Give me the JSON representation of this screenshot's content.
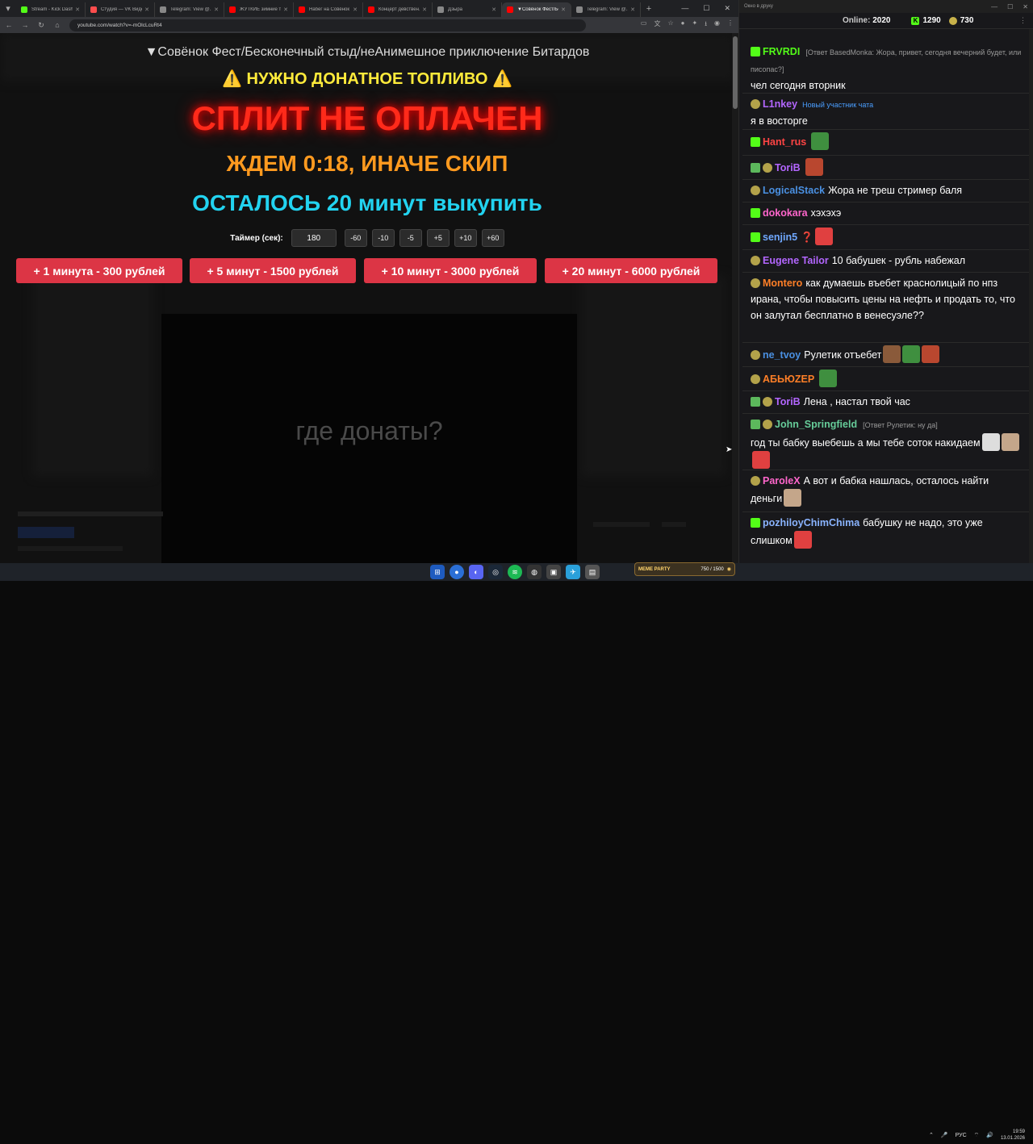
{
  "browser": {
    "tabs": [
      {
        "label": "Stream - Kick Dashb",
        "color": "#53fc18"
      },
      {
        "label": "Студия — VK Видео",
        "color": "#ff4d4d"
      },
      {
        "label": "Telegram: View @...",
        "color": "#888888"
      },
      {
        "label": "ЖУТКИЕ зимние т...",
        "color": "#ff0000"
      },
      {
        "label": "Набег на Совёнок",
        "color": "#ff0000"
      },
      {
        "label": "Концерт девствен...",
        "color": "#ff0000"
      },
      {
        "label": "Дзыра",
        "color": "#888888"
      },
      {
        "label": "▼Совёнок Фест/Бе...",
        "color": "#ff0000",
        "active": true
      },
      {
        "label": "Telegram: View @...",
        "color": "#888888"
      }
    ],
    "url": "youtube.com/watch?v=-mOlcLcuRt4"
  },
  "overlay": {
    "title": "▼Совёнок Фест/Бесконечный стыд/неАнимешное приключение Битардов",
    "fuel": "⚠️ НУЖНО ДОНАТНОЕ ТОПЛИВО ⚠️",
    "split": "СПЛИТ НЕ ОПЛАЧЕН",
    "wait": "ЖДЕМ 0:18, ИНАЧЕ СКИП",
    "remain": "ОСТАЛОСЬ 20 минут выкупить",
    "timer_label": "Таймер (сек):",
    "timer_value": "180",
    "timer_buttons": [
      "-60",
      "-10",
      "-5",
      "+5",
      "+10",
      "+60"
    ],
    "buy_buttons": [
      "+ 1 минута - 300 рублей",
      "+ 5 минут - 1500 рублей",
      "+ 10 минут - 3000 рублей",
      "+ 20 минут - 6000 рублей"
    ],
    "where": "где донаты?"
  },
  "chat": {
    "window_title": "Окно в друку",
    "online_label": "Online:",
    "online": "2020",
    "kick_count": "1290",
    "pepe_count": "730",
    "messages": [
      {
        "user": "FRVRDI",
        "color": "#53fc18",
        "reply": "[Ответ BasedMonka: Жора, привет, сегодня вечерний будет, или писопас?]",
        "text": "чел сегодня вторник"
      },
      {
        "user": "L1nkey",
        "color": "#b366ff",
        "tag": "Новый участник чата",
        "text": "я в восторге"
      },
      {
        "user": "Hant_rus",
        "color": "#ff4444",
        "text": ""
      },
      {
        "user": "ToriB",
        "color": "#b366ff",
        "text": ""
      },
      {
        "user": "LogicalStack",
        "color": "#4a90e2",
        "text": "Жора не треш стример баля"
      },
      {
        "user": "dokokara",
        "color": "#ff66cc",
        "text": "хэхэхэ"
      },
      {
        "user": "senjin5",
        "color": "#6fa8ff",
        "text": "❓"
      },
      {
        "user": "Eugene Tailor",
        "color": "#b366ff",
        "text": "10 бабушек - рубль набежал"
      },
      {
        "user": "Montero",
        "color": "#ff7f27",
        "text": "как думаешь въебет краснолицый по нпз ирана, чтобы повысить цены на нефть и продать то, что он залутал бесплатно в венесуэле??"
      },
      {
        "user": "ne_tvoy",
        "color": "#4a90e2",
        "text": "Рулетик отъебет"
      },
      {
        "user": "АБЬЮZЕР",
        "color": "#ff7f27",
        "text": ""
      },
      {
        "user": "ToriB",
        "color": "#b366ff",
        "text": "Лена , настал твой час"
      },
      {
        "user": "John_Springfield",
        "color": "#66cc99",
        "reply": "[Ответ Рулетик: ну да]",
        "text": "год ты бабку выебешь а мы тебе соток накидаем"
      },
      {
        "user": "ParoleX",
        "color": "#ff66cc",
        "text": "А вот и бабка нашлась, осталось найти деньги"
      },
      {
        "user": "pozhiloyChimChima",
        "color": "#8ab4ff",
        "text": "бабушку не надо, это уже слишком"
      }
    ]
  },
  "taskbar": {
    "widget_label": "MEME PARTY",
    "widget_value": "750 / 1500",
    "lang": "РУС",
    "time": "19:59",
    "date": "13.01.2026"
  }
}
